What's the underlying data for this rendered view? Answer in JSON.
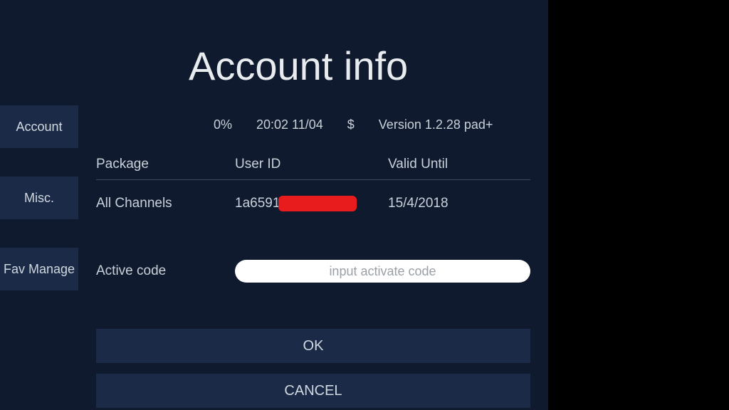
{
  "sidebar": {
    "items": [
      {
        "label": "Account"
      },
      {
        "label": "Misc."
      },
      {
        "label": "Fav Manage"
      }
    ]
  },
  "page": {
    "title": "Account info"
  },
  "status": {
    "percent": "0%",
    "time_date": "20:02 11/04",
    "currency": "$",
    "version": "Version 1.2.28 pad+"
  },
  "table": {
    "headers": {
      "package": "Package",
      "user_id": "User ID",
      "valid_until": "Valid Until"
    },
    "row": {
      "package": "All Channels",
      "user_id_partial": "1a6591",
      "valid_until": "15/4/2018"
    }
  },
  "active_code": {
    "label": "Active code",
    "placeholder": "input activate code",
    "value": ""
  },
  "buttons": {
    "ok": "OK",
    "cancel": "CANCEL"
  }
}
